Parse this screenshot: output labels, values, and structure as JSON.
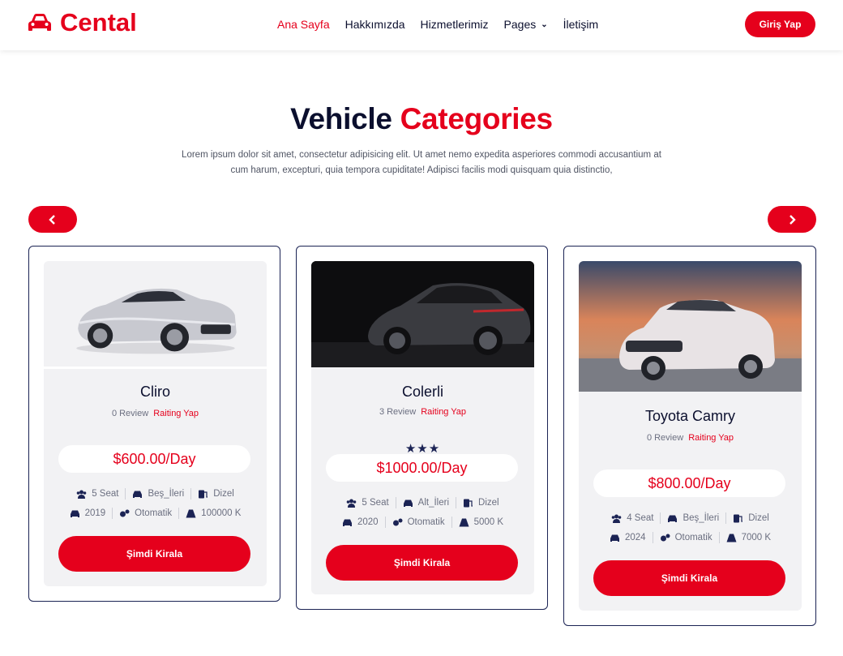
{
  "brand": {
    "name": "Cental",
    "color": "#e5001c"
  },
  "nav": {
    "items": [
      "Ana Sayfa",
      "Hakkımızda",
      "Hizmetlerimiz",
      "Pages",
      "İletişim"
    ],
    "active_index": 0,
    "login_label": "Giriş Yap"
  },
  "section": {
    "title_part1": "Vehicle",
    "title_part2": "Categories",
    "subtitle": "Lorem ipsum dolor sit amet, consectetur adipisicing elit. Ut amet nemo expedita asperiores commodi accusantium at cum harum, excepturi, quia tempora cupiditate! Adipisci facilis modi quisquam quia distinctio,"
  },
  "carousel": {
    "prev_icon": "chevron-left-icon",
    "next_icon": "chevron-right-icon"
  },
  "cars": [
    {
      "name": "Cliro",
      "review": "0 Review",
      "rating_label": "Raiting Yap",
      "stars": "",
      "price": "$600.00/Day",
      "seats": "5 Seat",
      "gear_type": "Beş_İleri",
      "fuel": "Dizel",
      "year": "2019",
      "transmission": "Otomatik",
      "mileage": "100000 K",
      "button": "Şimdi Kirala",
      "image": "silver-sports-car"
    },
    {
      "name": "Colerli",
      "review": "3 Review",
      "rating_label": "Raiting Yap",
      "stars": "★★★",
      "price": "$1000.00/Day",
      "seats": "5 Seat",
      "gear_type": "Alt_İleri",
      "fuel": "Dizel",
      "year": "2020",
      "transmission": "Otomatik",
      "mileage": "5000 K",
      "button": "Şimdi Kirala",
      "image": "dark-suv-studio"
    },
    {
      "name": "Toyota Camry",
      "review": "0 Review",
      "rating_label": "Raiting Yap",
      "stars": "",
      "price": "$800.00/Day",
      "seats": "4 Seat",
      "gear_type": "Beş_İleri",
      "fuel": "Dizel",
      "year": "2024",
      "transmission": "Otomatik",
      "mileage": "7000 K",
      "button": "Şimdi Kirala",
      "image": "white-suv-sunset"
    }
  ]
}
